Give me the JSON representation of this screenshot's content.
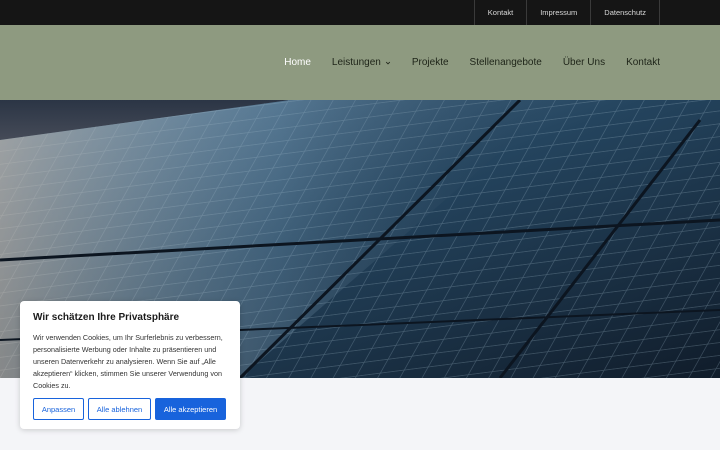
{
  "topbar": {
    "links": [
      "Kontakt",
      "Impressum",
      "Datenschutz"
    ]
  },
  "nav": {
    "items": [
      {
        "label": "Home",
        "active": true
      },
      {
        "label": "Leistungen",
        "has_dropdown": true
      },
      {
        "label": "Projekte"
      },
      {
        "label": "Stellenangebote"
      },
      {
        "label": "Über Uns"
      },
      {
        "label": "Kontakt"
      }
    ],
    "dropdown_icon": "chevron-down-icon"
  },
  "hero": {
    "image": "solar-panels-at-sunset"
  },
  "cookie_banner": {
    "title": "Wir schätzen Ihre Privatsphäre",
    "text": "Wir verwenden Cookies, um Ihr Surferlebnis zu verbessern, personalisierte Werbung oder Inhalte zu präsentieren und unseren Datenverkehr zu analysieren. Wenn Sie auf „Alle akzeptieren“ klicken, stimmen Sie unserer Verwendung von Cookies zu.",
    "buttons": {
      "customize": "Anpassen",
      "reject_all": "Alle ablehnen",
      "accept_all": "Alle akzeptieren"
    }
  },
  "colors": {
    "topbar_bg": "#151515",
    "header_bg": "#8e9a80",
    "accent": "#1863dc",
    "page_bg": "#f4f5f8"
  }
}
